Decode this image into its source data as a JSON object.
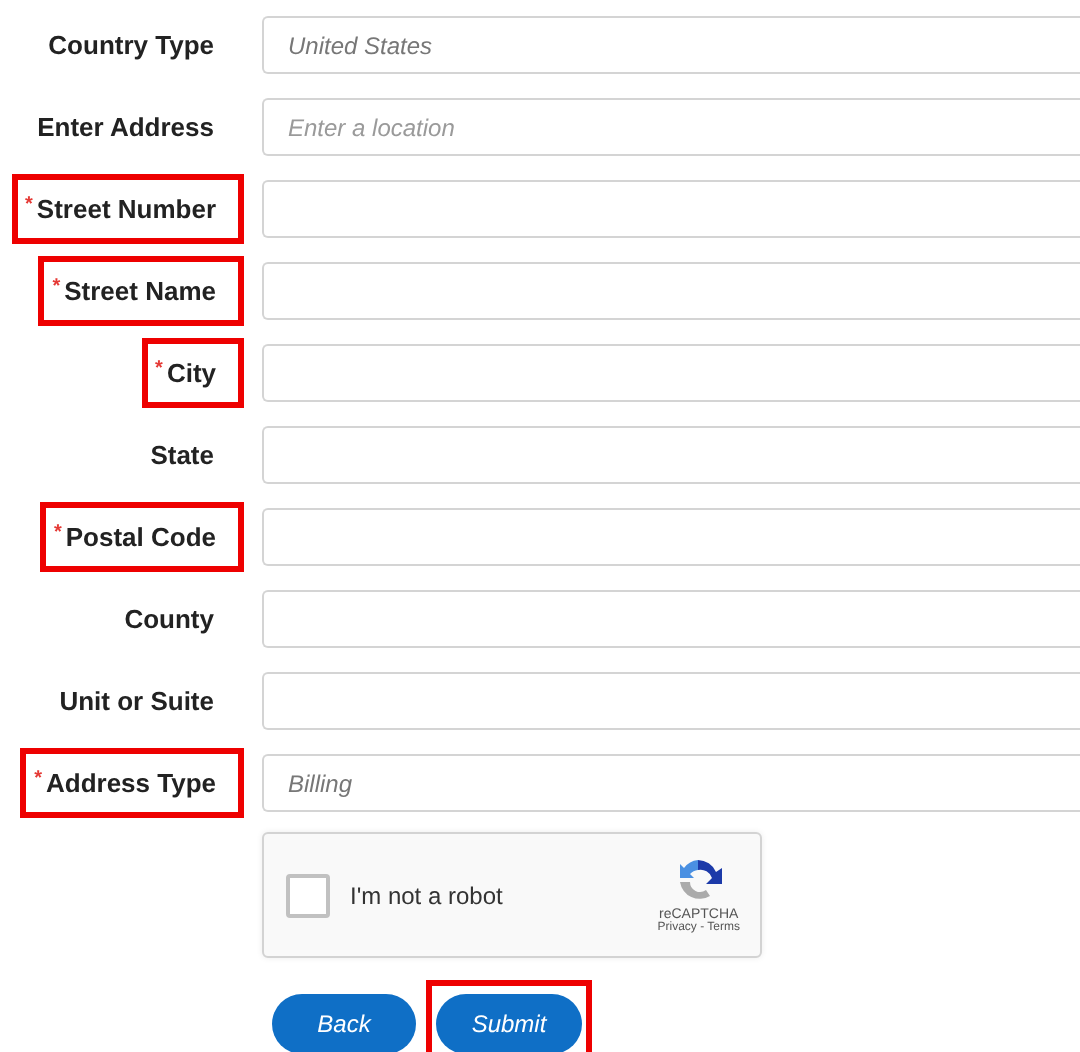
{
  "fields": [
    {
      "label": "Country Type",
      "required": false,
      "highlighted": false,
      "kind": "select",
      "value": "United States"
    },
    {
      "label": "Enter Address",
      "required": false,
      "highlighted": false,
      "kind": "text",
      "placeholder": "Enter a location"
    },
    {
      "label": "Street Number",
      "required": true,
      "highlighted": true,
      "kind": "text"
    },
    {
      "label": "Street Name",
      "required": true,
      "highlighted": true,
      "kind": "text"
    },
    {
      "label": "City",
      "required": true,
      "highlighted": true,
      "kind": "text"
    },
    {
      "label": "State",
      "required": false,
      "highlighted": false,
      "kind": "text"
    },
    {
      "label": "Postal Code",
      "required": true,
      "highlighted": true,
      "kind": "text"
    },
    {
      "label": "County",
      "required": false,
      "highlighted": false,
      "kind": "text"
    },
    {
      "label": "Unit or Suite",
      "required": false,
      "highlighted": false,
      "kind": "text"
    },
    {
      "label": "Address Type",
      "required": true,
      "highlighted": true,
      "kind": "select",
      "value": "Billing"
    }
  ],
  "required_mark": "*",
  "captcha": {
    "label": "I'm not a robot",
    "checked": false,
    "brand": "reCAPTCHA",
    "links": "Privacy - Terms"
  },
  "buttons": [
    {
      "label": "Back",
      "highlighted": false
    },
    {
      "label": "Submit",
      "highlighted": true
    }
  ]
}
